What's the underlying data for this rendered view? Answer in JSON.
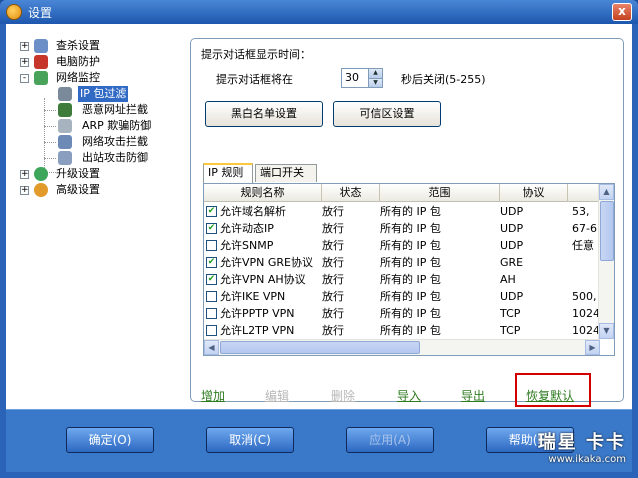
{
  "window": {
    "title": "设置",
    "close": "x"
  },
  "tree": {
    "items": [
      {
        "label": "查杀设置",
        "icon": "magnifier-icon",
        "expander": "+"
      },
      {
        "label": "电脑防护",
        "icon": "shield-icon",
        "expander": "+"
      },
      {
        "label": "网络监控",
        "icon": "network-icon",
        "expander": "-"
      },
      {
        "label": "IP 包过滤",
        "icon": "filter-icon",
        "selected": true
      },
      {
        "label": "恶意网址拦截",
        "icon": "url-block-icon"
      },
      {
        "label": "ARP 欺骗防御",
        "icon": "arp-icon"
      },
      {
        "label": "网络攻击拦截",
        "icon": "attack-block-icon"
      },
      {
        "label": "出站攻击防御",
        "icon": "outbound-icon"
      },
      {
        "label": "升级设置",
        "icon": "update-icon",
        "expander": "+"
      },
      {
        "label": "高级设置",
        "icon": "gear-icon",
        "expander": "+"
      }
    ]
  },
  "popup": {
    "heading": "提示对话框显示时间：",
    "prefix": "提示对话框将在",
    "value": "30",
    "suffix": "秒后关闭(5-255)"
  },
  "buttons": {
    "blacklist": "黑白名单设置",
    "trusted": "可信区设置"
  },
  "tabs": [
    "IP 规则",
    "端口开关"
  ],
  "table": {
    "headers": [
      "规则名称",
      "状态",
      "范围",
      "协议"
    ],
    "rows": [
      {
        "checked": true,
        "name": "允许域名解析",
        "status": "放行",
        "range": "所有的 IP 包",
        "protocol": "UDP",
        "extra": "53,"
      },
      {
        "checked": true,
        "name": "允许动态IP",
        "status": "放行",
        "range": "所有的 IP 包",
        "protocol": "UDP",
        "extra": "67-6"
      },
      {
        "checked": false,
        "name": "允许SNMP",
        "status": "放行",
        "range": "所有的 IP 包",
        "protocol": "UDP",
        "extra": "任意"
      },
      {
        "checked": true,
        "name": "允许VPN GRE协议",
        "status": "放行",
        "range": "所有的 IP 包",
        "protocol": "GRE",
        "extra": ""
      },
      {
        "checked": true,
        "name": "允许VPN AH协议",
        "status": "放行",
        "range": "所有的 IP 包",
        "protocol": "AH",
        "extra": ""
      },
      {
        "checked": false,
        "name": "允许IKE VPN",
        "status": "放行",
        "range": "所有的 IP 包",
        "protocol": "UDP",
        "extra": "500,"
      },
      {
        "checked": false,
        "name": "允许PPTP VPN",
        "status": "放行",
        "range": "所有的 IP 包",
        "protocol": "TCP",
        "extra": "1024"
      },
      {
        "checked": false,
        "name": "允许L2TP VPN",
        "status": "放行",
        "range": "所有的 IP 包",
        "protocol": "TCP",
        "extra": "1024"
      }
    ]
  },
  "actions": {
    "add": "增加",
    "edit": "编辑",
    "delete": "删除",
    "import": "导入",
    "export": "导出",
    "restore": "恢复默认"
  },
  "footer": {
    "ok": "确定(O)",
    "cancel": "取消(C)",
    "apply": "应用(A)",
    "help": "帮助(H)"
  },
  "watermark": {
    "brand": "瑞星 卡卡",
    "url": "www.ikaka.com"
  },
  "colors": {
    "accent": "#316ac5",
    "highlight_border": "#d40000",
    "link_green": "#2d7b1f"
  }
}
